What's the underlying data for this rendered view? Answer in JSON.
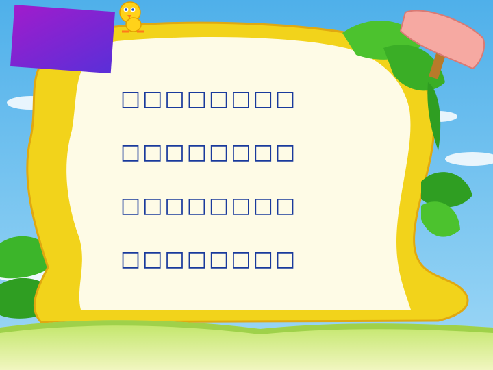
{
  "slide": {
    "poem_lines": [
      "□□□□□□□□",
      "□□□□□□□□",
      "□□□□□□□□",
      "□□□□□□□□"
    ]
  },
  "colors": {
    "sky": "#7dc4f0",
    "frame": "#f2d31b",
    "panel": "#fefbe6",
    "leaf": "#3fbf2a",
    "grass": "#c8e86a",
    "text": "#1a3a9c",
    "purple_box": "#8f20cf",
    "sign": "#f6a9a2"
  },
  "icons": [
    "cartoon-bird-icon",
    "leaf-icon",
    "signpost-icon"
  ]
}
